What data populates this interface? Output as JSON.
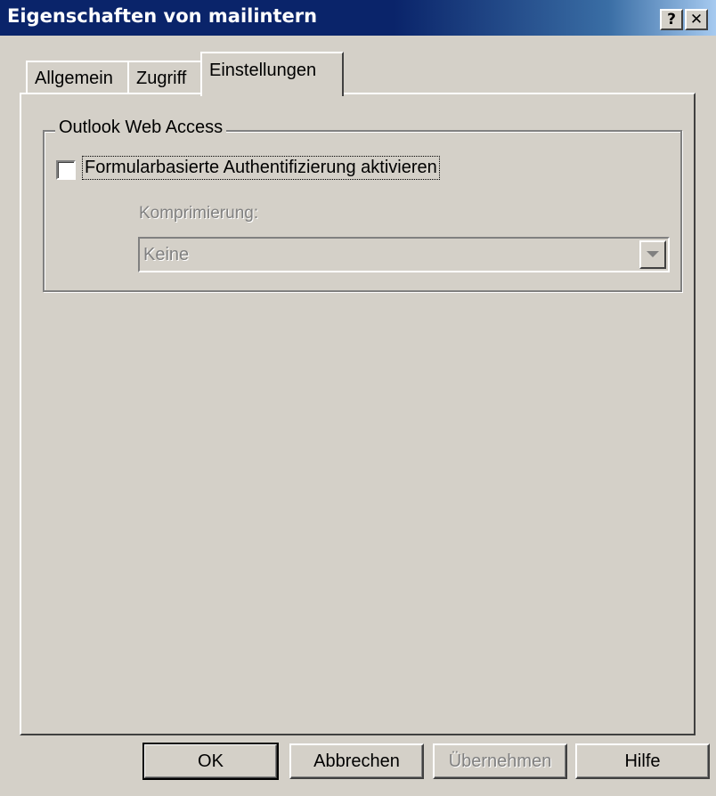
{
  "window": {
    "title": "Eigenschaften von mailintern",
    "help_button": "?",
    "close_button": "✕"
  },
  "tabs": [
    {
      "label": "Allgemein",
      "selected": false
    },
    {
      "label": "Zugriff",
      "selected": false
    },
    {
      "label": "Einstellungen",
      "selected": true
    }
  ],
  "group": {
    "label": "Outlook Web Access",
    "checkbox": {
      "label": "Formularbasierte Authentifizierung aktivieren",
      "checked": false
    },
    "compression": {
      "label": "Komprimierung:",
      "value": "Keine",
      "enabled": false
    }
  },
  "buttons": {
    "ok": "OK",
    "cancel": "Abbrechen",
    "apply": "Übernehmen",
    "help": "Hilfe"
  },
  "colors": {
    "titlebar": "#0a246a",
    "face": "#d4d0c8",
    "disabled_text": "#808080"
  }
}
